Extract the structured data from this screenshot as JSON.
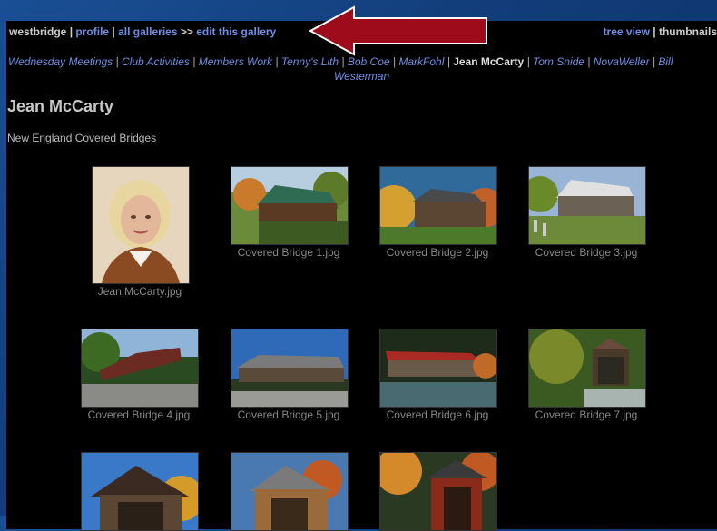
{
  "topbar": {
    "site": "westbridge",
    "profile": "profile",
    "all_galleries": "all galleries",
    "arrows": ">>",
    "edit": "edit this gallery",
    "tree_view": "tree view",
    "thumbnails": "thumbnails"
  },
  "nav": {
    "items": [
      "Wednesday Meetings",
      "Club Activities",
      "Members Work",
      "Tenny's Lith",
      "Bob Coe",
      "MarkFohl",
      "Jean McCarty",
      "Tom Snide",
      "NovaWeller",
      "Bill"
    ],
    "last": "Westerman"
  },
  "gallery": {
    "title": "Jean McCarty",
    "description": "New England Covered Bridges",
    "images": [
      "Jean McCarty.jpg",
      "Covered Bridge 1.jpg",
      "Covered Bridge 2.jpg",
      "Covered Bridge 3.jpg",
      "Covered Bridge 4.jpg",
      "Covered Bridge 5.jpg",
      "Covered Bridge 6.jpg",
      "Covered Bridge 7.jpg"
    ]
  },
  "colors": {
    "link": "#6f8fe6",
    "arrow": "#9e0b1b",
    "background": "#000000"
  }
}
